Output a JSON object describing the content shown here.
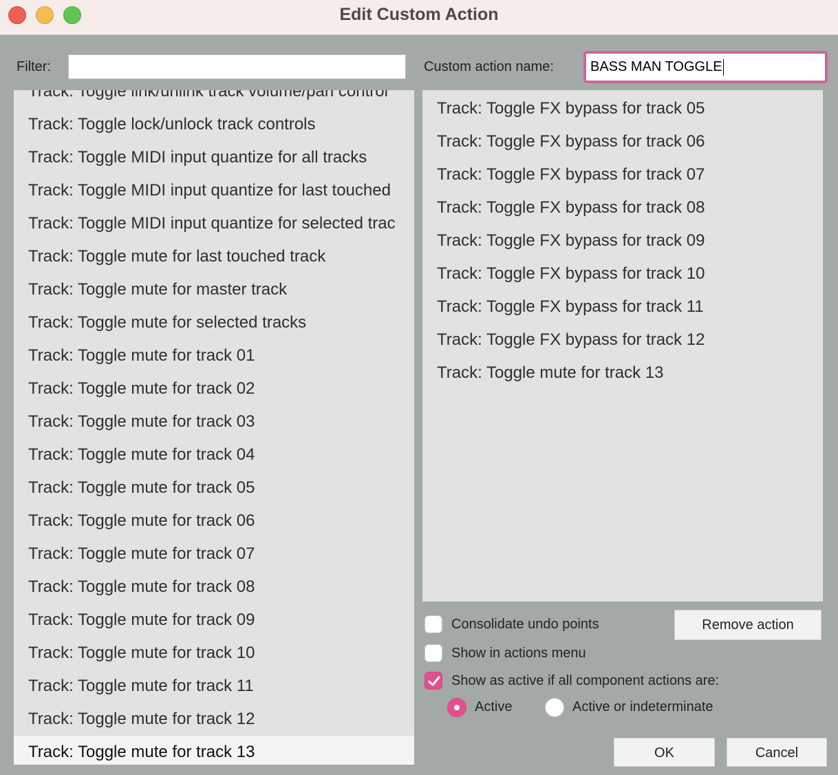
{
  "window": {
    "title": "Edit Custom Action"
  },
  "filter": {
    "label": "Filter:",
    "value": ""
  },
  "custom_name": {
    "label": "Custom action name:",
    "value": "BASS MAN TOGGLE"
  },
  "left_list": {
    "items": [
      "Track: Toggle link/unlink track volume/pan control",
      "Track: Toggle lock/unlock track controls",
      "Track: Toggle MIDI input quantize for all tracks",
      "Track: Toggle MIDI input quantize for last touched",
      "Track: Toggle MIDI input quantize for selected trac",
      "Track: Toggle mute for last touched track",
      "Track: Toggle mute for master track",
      "Track: Toggle mute for selected tracks",
      "Track: Toggle mute for track 01",
      "Track: Toggle mute for track 02",
      "Track: Toggle mute for track 03",
      "Track: Toggle mute for track 04",
      "Track: Toggle mute for track 05",
      "Track: Toggle mute for track 06",
      "Track: Toggle mute for track 07",
      "Track: Toggle mute for track 08",
      "Track: Toggle mute for track 09",
      "Track: Toggle mute for track 10",
      "Track: Toggle mute for track 11",
      "Track: Toggle mute for track 12",
      "Track: Toggle mute for track 13"
    ],
    "selected": "Track: Toggle mute for track 13"
  },
  "right_list": {
    "items": [
      "Track: Toggle FX bypass for track 05",
      "Track: Toggle FX bypass for track 06",
      "Track: Toggle FX bypass for track 07",
      "Track: Toggle FX bypass for track 08",
      "Track: Toggle FX bypass for track 09",
      "Track: Toggle FX bypass for track 10",
      "Track: Toggle FX bypass for track 11",
      "Track: Toggle FX bypass for track 12",
      "Track: Toggle mute for track 13"
    ]
  },
  "buttons": {
    "remove_action": "Remove action",
    "ok": "OK",
    "cancel": "Cancel"
  },
  "options": {
    "consolidate_undo": {
      "label": "Consolidate undo points",
      "checked": false
    },
    "show_in_menu": {
      "label": "Show in actions menu",
      "checked": false
    },
    "show_as_active": {
      "label": "Show as active if all component actions are:",
      "checked": true
    }
  },
  "active_mode": {
    "options": [
      "Active",
      "Active or indeterminate"
    ],
    "selected": "Active"
  },
  "colors": {
    "accent": "#e2508f",
    "focus_ring": "#c8689a",
    "background": "#a3aaa6",
    "list_bg": "#e1e2e1"
  }
}
